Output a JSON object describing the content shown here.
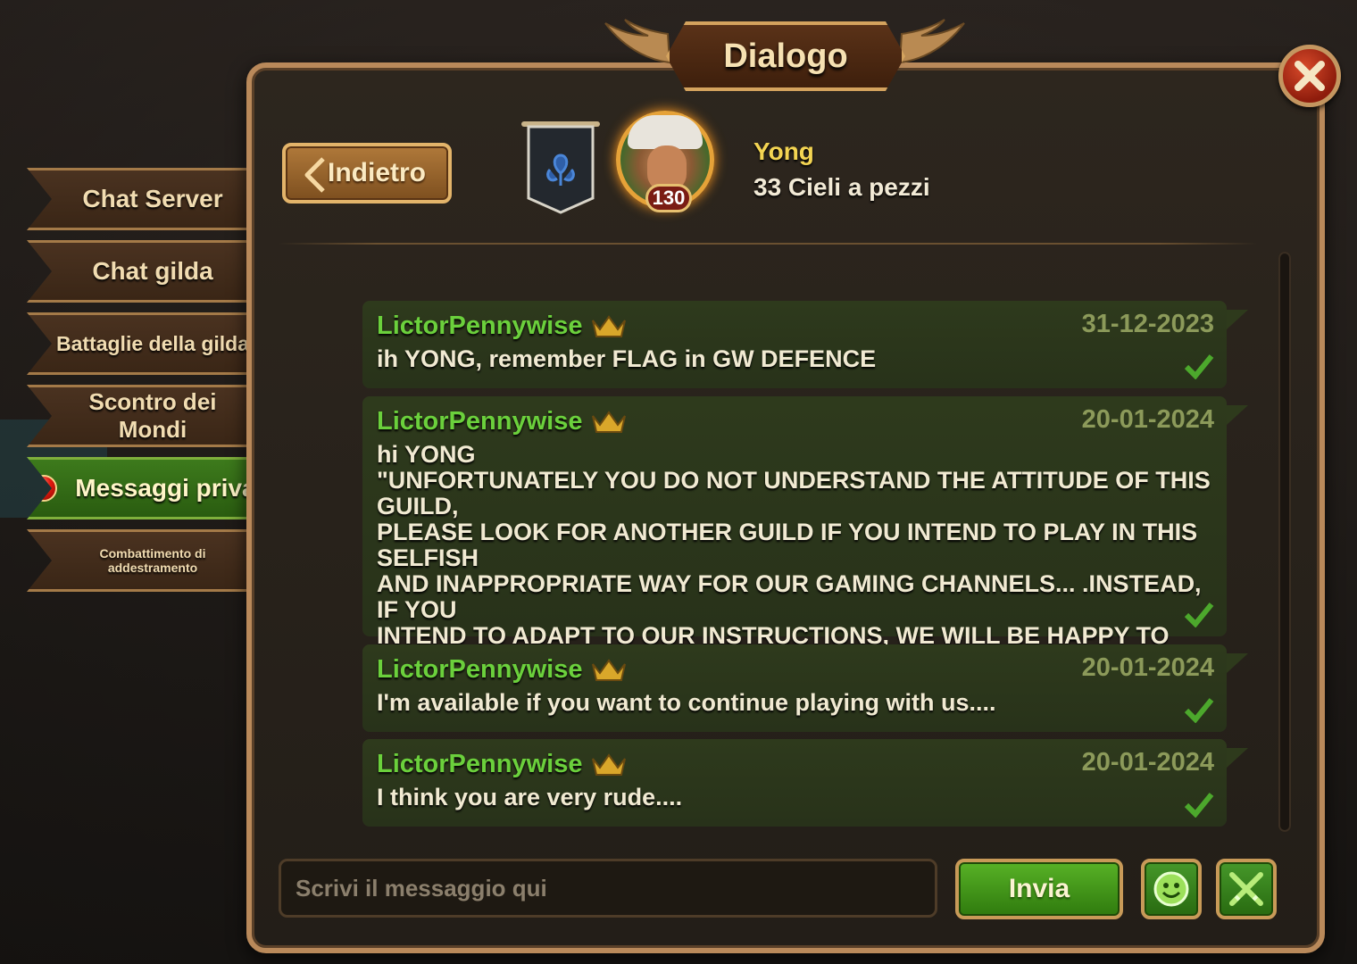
{
  "window": {
    "title": "Dialogo"
  },
  "tabs": [
    {
      "label": "Chat Server",
      "active": false
    },
    {
      "label": "Chat gilda",
      "active": false
    },
    {
      "label": "Battaglie della gilda",
      "active": false
    },
    {
      "label": "Scontro dei Mondi",
      "active": false
    },
    {
      "label": "Messaggi privati",
      "active": true,
      "notification": true
    },
    {
      "label": "Combattimento di addestramento",
      "active": false
    }
  ],
  "header": {
    "back_label": "Indietro",
    "user_name": "Yong",
    "user_guild": "33 Cieli a pezzi",
    "level": "130"
  },
  "messages": [
    {
      "sender": "LictorPennywise",
      "date": "31-12-2023",
      "text": "ih YONG, remember FLAG in GW DEFENCE"
    },
    {
      "sender": "LictorPennywise",
      "date": "20-01-2024",
      "text": "hi YONG\n\"UNFORTUNATELY YOU DO NOT UNDERSTAND THE ATTITUDE OF THIS GUILD,\nPLEASE LOOK FOR ANOTHER GUILD IF YOU INTEND TO PLAY IN THIS SELFISH\nAND INAPPROPRIATE WAY FOR OUR GAMING CHANNELS... .INSTEAD, IF YOU\nINTEND TO ADAPT TO OUR INSTRUCTIONS, WE WILL BE HAPPY TO CONTINUE\nPLAYING TOGETHER...let us know\"\nthank you"
    },
    {
      "sender": "LictorPennywise",
      "date": "20-01-2024",
      "text": "I'm available if you want to continue playing with us...."
    },
    {
      "sender": "LictorPennywise",
      "date": "20-01-2024",
      "text": "I think you are very rude...."
    }
  ],
  "composer": {
    "placeholder": "Scrivi il messaggio qui",
    "send_label": "Invia"
  },
  "colors": {
    "sender": "#6bd03c",
    "date": "#8c9a5a",
    "accent_gold": "#c89a58",
    "active_tab": "#3d7a1c"
  }
}
